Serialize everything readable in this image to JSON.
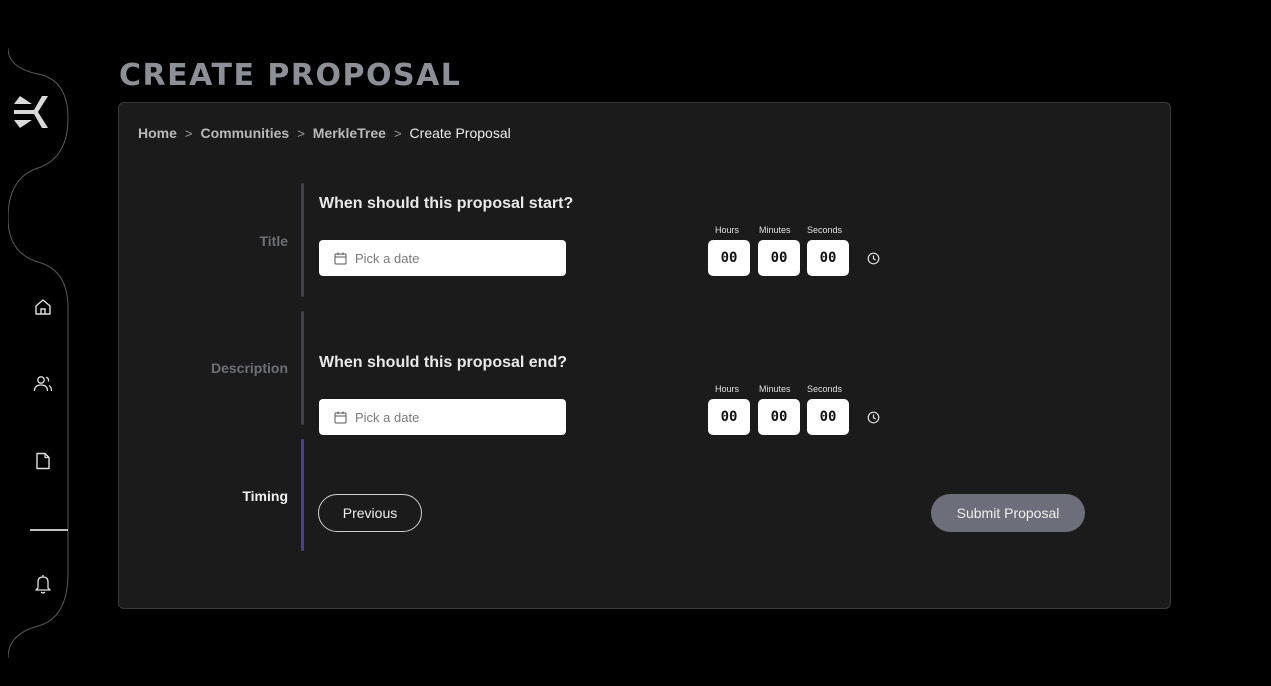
{
  "page": {
    "title": "CREATE PROPOSAL"
  },
  "breadcrumb": [
    "Home",
    "Communities",
    "MerkleTree",
    "Create Proposal"
  ],
  "breadcrumb_separator": ">",
  "steps": [
    {
      "label": "Title",
      "state": "done"
    },
    {
      "label": "Description",
      "state": "done"
    },
    {
      "label": "Timing",
      "state": "active"
    }
  ],
  "start": {
    "question": "When should this proposal start?",
    "date_placeholder": "Pick a date",
    "hours_label": "Hours",
    "minutes_label": "Minutes",
    "seconds_label": "Seconds",
    "hours": "00",
    "minutes": "00",
    "seconds": "00"
  },
  "end": {
    "question": "When should this proposal end?",
    "date_placeholder": "Pick a date",
    "hours_label": "Hours",
    "minutes_label": "Minutes",
    "seconds_label": "Seconds",
    "hours": "00",
    "minutes": "00",
    "seconds": "00"
  },
  "buttons": {
    "previous": "Previous",
    "submit": "Submit Proposal"
  },
  "sidebar": {
    "icons": [
      "logo-icon",
      "home-icon",
      "users-icon",
      "document-icon",
      "bell-icon"
    ]
  },
  "colors": {
    "background": "#000000",
    "panel": "#1b1b1b",
    "title": "#8c8f96",
    "active_step": "#4b3aa8",
    "done_step": "#3f4248",
    "submit_button": "#6c6f79"
  }
}
